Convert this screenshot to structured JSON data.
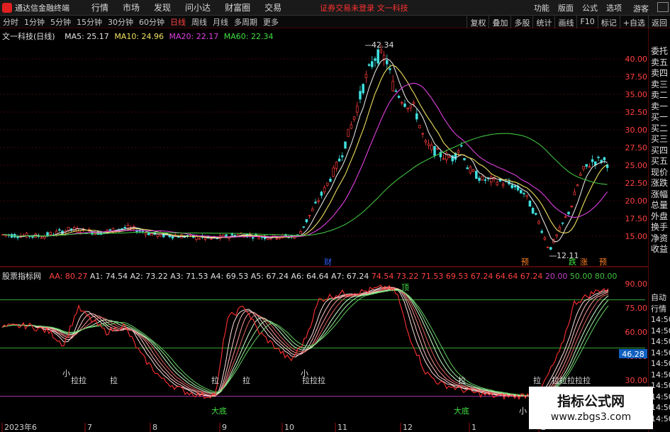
{
  "menubar": {
    "app_title": "通达信金融终端",
    "items": [
      "行情",
      "市场",
      "发现",
      "问小达",
      "财富圈",
      "交易"
    ],
    "login_status": "证券交易未登录  文一科技",
    "right_items": [
      "功能",
      "版面",
      "公式",
      "选项"
    ],
    "guest": "游客"
  },
  "toolbar": {
    "periods": [
      "分时",
      "1分钟",
      "5分钟",
      "15分钟",
      "30分钟",
      "60分钟",
      "日线",
      "周线",
      "月线",
      "多周期",
      "更多"
    ],
    "active_period": "日线",
    "buttons": [
      "复权",
      "叠加",
      "多股",
      "统计",
      "画线",
      "F10",
      "标记",
      "+自选",
      "返回"
    ]
  },
  "main_chart": {
    "stock": "文一科技(日线)",
    "ma": [
      {
        "label": "MA5: 25.17",
        "color": "#e0e0e0"
      },
      {
        "label": "MA10: 24.96",
        "color": "#f0e060"
      },
      {
        "label": "MA20: 22.17",
        "color": "#e040e0"
      },
      {
        "label": "MA60: 22.34",
        "color": "#40e040"
      }
    ],
    "high_label": "42.34",
    "low_label": "12.11",
    "markers": [
      "财",
      "预",
      "跌",
      "涨",
      "预"
    ]
  },
  "sub_chart": {
    "name": "股票指标网",
    "values": [
      {
        "label": "AA: 80.27",
        "color": "#ff4040"
      },
      {
        "label": "A1: 74.54",
        "color": "#e0e0e0"
      },
      {
        "label": "A2: 73.22",
        "color": "#e0e0e0"
      },
      {
        "label": "A3: 71.53",
        "color": "#e0e0e0"
      },
      {
        "label": "A4: 69.53",
        "color": "#e0e0e0"
      },
      {
        "label": "A5: 67.24",
        "color": "#e0e0e0"
      },
      {
        "label": "A6: 64.64",
        "color": "#e0e0e0"
      },
      {
        "label": "A7: 67.24",
        "color": "#e0e0e0"
      },
      {
        "label": "74.54",
        "color": "#ff4040"
      },
      {
        "label": "73.22",
        "color": "#ff4040"
      },
      {
        "label": "71.53",
        "color": "#ff4040"
      },
      {
        "label": "69.53",
        "color": "#ff4040"
      },
      {
        "label": "67.24",
        "color": "#ff4040"
      },
      {
        "label": "64.64",
        "color": "#ff4040"
      },
      {
        "label": "67.24",
        "color": "#ff4040"
      },
      {
        "label": "20.00",
        "color": "#c040c0"
      },
      {
        "label": "50.00",
        "color": "#40c040"
      },
      {
        "label": "80.00",
        "color": "#40c040"
      }
    ],
    "annotations": [
      "顶",
      "大底",
      "大底",
      "小",
      "小",
      "小",
      "拉拉",
      "拉",
      "拉",
      "拉",
      "拉拉拉",
      "拉",
      "拉",
      "拉拉拉拉拉"
    ],
    "current_value": "46.28"
  },
  "price_axis": [
    "40.00",
    "37.50",
    "35.00",
    "32.50",
    "30.00",
    "27.50",
    "25.00",
    "22.50",
    "20.00",
    "17.50",
    "15.00"
  ],
  "sub_axis": [
    "90.00",
    "75.00",
    "60.00",
    "45.00",
    "30.00"
  ],
  "date_axis": [
    "2023年6",
    "7",
    "8",
    "9",
    "10",
    "11",
    "12",
    "1",
    "2"
  ],
  "right_panel": [
    "委托",
    "卖五",
    "卖四",
    "卖三",
    "卖二",
    "卖一",
    "买一",
    "买二",
    "买三",
    "买四",
    "买五",
    "现价",
    "涨跌",
    "涨幅",
    "总量",
    "外盘",
    "换手",
    "净资",
    "收益"
  ],
  "right_panel2": [
    "自动",
    "行情",
    "14:50",
    "14:50",
    "14:50",
    "14:50",
    "14:50",
    "14:50",
    "14:50",
    "14:50",
    "14:50",
    "14:50"
  ],
  "watermark": {
    "title": "指标公式网",
    "url": "www.zbgs3.com"
  },
  "colors": {
    "up": "#ff3c3c",
    "down": "#40e0e0",
    "grid": "#7a1010",
    "ma5": "#e0e0e0",
    "ma10": "#f0e060",
    "ma20": "#e040e0",
    "ma60": "#40c040"
  }
}
